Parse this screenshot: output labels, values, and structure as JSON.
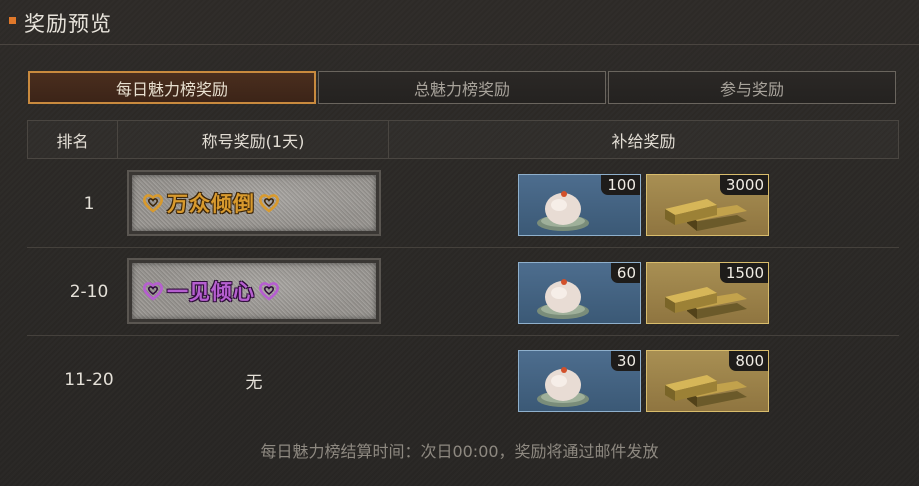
{
  "header": {
    "title": "奖励预览"
  },
  "tabs": [
    {
      "label": "每日魅力榜奖励",
      "active": true
    },
    {
      "label": "总魅力榜奖励",
      "active": false
    },
    {
      "label": "参与奖励",
      "active": false
    }
  ],
  "table": {
    "headers": {
      "rank": "排名",
      "title": "称号奖励(1天)",
      "supply": "补给奖励"
    },
    "rows": [
      {
        "rank": "1",
        "title_name": "万众倾倒",
        "title_style": "gold",
        "bun_qty": "100",
        "gold_qty": "3000"
      },
      {
        "rank": "2-10",
        "title_name": "一见倾心",
        "title_style": "purple",
        "bun_qty": "60",
        "gold_qty": "1500"
      },
      {
        "rank": "11-20",
        "title_name": "无",
        "title_style": "none",
        "bun_qty": "30",
        "gold_qty": "800"
      }
    ]
  },
  "footer": {
    "note": "每日魅力榜结算时间：次日00:00，奖励将通过邮件发放"
  },
  "colors": {
    "accent": "#e0782a",
    "tab_active_border": "#c98a3e",
    "bun_item_bg": "#4d6d8e",
    "gold_item_bg": "#a88f53",
    "gold_title": "#d89a2e",
    "purple_title": "#b65fd0"
  },
  "icons": {
    "bun": "steamed-bun-on-leaf-icon",
    "gold": "gold-bars-icon",
    "heart": "heart-swirl-icon"
  }
}
